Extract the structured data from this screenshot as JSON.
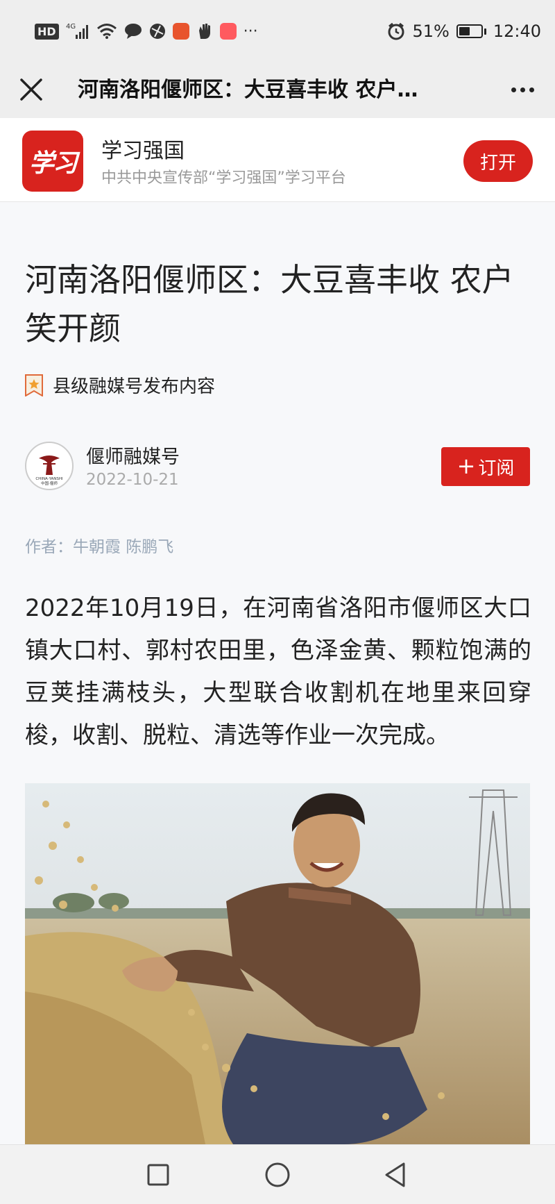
{
  "status_bar": {
    "network": "HD",
    "signal": "4G",
    "more": "···",
    "battery_percent": "51%",
    "battery_level": 0.51,
    "time": "12:40"
  },
  "nav": {
    "title": "河南洛阳偃师区：大豆喜丰收 农户…",
    "close_icon": "close-icon",
    "more_icon": "more-dots-icon"
  },
  "app_banner": {
    "logo_text": "学习",
    "name": "学习强国",
    "subtitle": "中共中央宣传部“学习强国”学习平台",
    "open_label": "打开",
    "brand_color": "#d8231e"
  },
  "article": {
    "title": "河南洛阳偃师区：大豆喜丰收 农户笑开颜",
    "tag": "县级融媒号发布内容",
    "author_name": "偃师融媒号",
    "date": "2022-10-21",
    "subscribe_label": "订阅",
    "avatar_text_top": "CHINA·YANSHI",
    "avatar_text_bottom": "中国·偃师",
    "byline": "作者：牛朝霞 陈鹏飞",
    "body": "2022年10月19日，在河南省洛阳市偃师区大口镇大口村、郭村农田里，色泽金黄、颗粒饱满的豆荚挂满枝头，大型联合收割机在地里来回穿梭，收割、脱粒、清选等作业一次完成。"
  },
  "bottom_nav": {
    "square_icon": "recent-apps-icon",
    "circle_icon": "home-icon",
    "triangle_icon": "back-icon"
  }
}
